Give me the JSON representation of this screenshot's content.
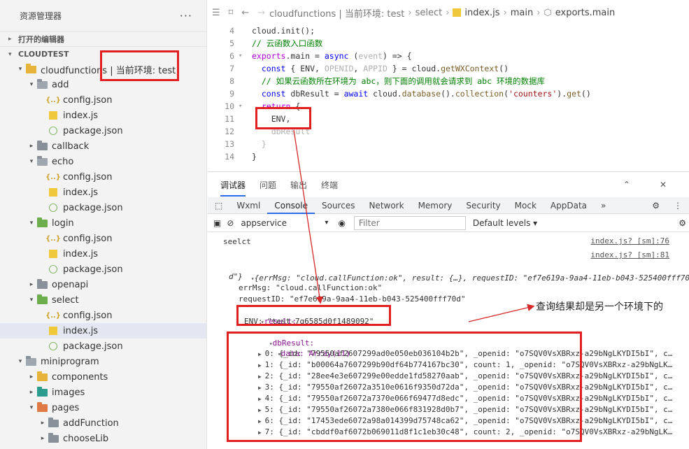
{
  "explorer": {
    "title": "资源管理器",
    "more": "···",
    "open_editors": "打开的编辑器",
    "project": "CLOUDTEST",
    "tree": [
      {
        "label": "cloudfunctions | 当前环境: test",
        "indent": 1,
        "kind": "folder-yellow-open",
        "twisty": "▾"
      },
      {
        "label": "add",
        "indent": 2,
        "kind": "folder-open",
        "twisty": "▾"
      },
      {
        "label": "config.json",
        "indent": 3,
        "kind": "json"
      },
      {
        "label": "index.js",
        "indent": 3,
        "kind": "js"
      },
      {
        "label": "package.json",
        "indent": 3,
        "kind": "pkg"
      },
      {
        "label": "callback",
        "indent": 2,
        "kind": "folder",
        "twisty": "▸"
      },
      {
        "label": "echo",
        "indent": 2,
        "kind": "folder-open",
        "twisty": "▾"
      },
      {
        "label": "config.json",
        "indent": 3,
        "kind": "json"
      },
      {
        "label": "index.js",
        "indent": 3,
        "kind": "js"
      },
      {
        "label": "package.json",
        "indent": 3,
        "kind": "pkg"
      },
      {
        "label": "login",
        "indent": 2,
        "kind": "folder-green-open",
        "twisty": "▾"
      },
      {
        "label": "config.json",
        "indent": 3,
        "kind": "json"
      },
      {
        "label": "index.js",
        "indent": 3,
        "kind": "js"
      },
      {
        "label": "package.json",
        "indent": 3,
        "kind": "pkg"
      },
      {
        "label": "openapi",
        "indent": 2,
        "kind": "folder",
        "twisty": "▸"
      },
      {
        "label": "select",
        "indent": 2,
        "kind": "folder-green-open",
        "twisty": "▾"
      },
      {
        "label": "config.json",
        "indent": 3,
        "kind": "json"
      },
      {
        "label": "index.js",
        "indent": 3,
        "kind": "js",
        "selected": true
      },
      {
        "label": "package.json",
        "indent": 3,
        "kind": "pkg"
      },
      {
        "label": "miniprogram",
        "indent": 1,
        "kind": "folder-open",
        "twisty": "▾"
      },
      {
        "label": "components",
        "indent": 2,
        "kind": "folder-yellow",
        "twisty": "▸"
      },
      {
        "label": "images",
        "indent": 2,
        "kind": "folder-teal",
        "twisty": "▸"
      },
      {
        "label": "pages",
        "indent": 2,
        "kind": "folder-orange-open",
        "twisty": "▾"
      },
      {
        "label": "addFunction",
        "indent": 3,
        "kind": "folder",
        "twisty": "▸"
      },
      {
        "label": "chooseLib",
        "indent": 3,
        "kind": "folder",
        "twisty": "▸"
      }
    ]
  },
  "breadcrumb": {
    "items": [
      "cloudfunctions | 当前环境: test",
      "select",
      "index.js",
      "main",
      "exports.main"
    ]
  },
  "editor": {
    "lines": [
      {
        "n": "4",
        "html": "cloud.init();"
      },
      {
        "n": "5",
        "html": "<span class='cm'>// 云函数入口函数</span>"
      },
      {
        "n": "6",
        "fold": "▾",
        "html": "<span class='kw2'>exports</span>.main = <span class='kw'>async</span> (<span class='pr'>event</span>) =&gt; {"
      },
      {
        "n": "7",
        "html": "  <span class='kw'>const</span> { ENV, <span class='pr'>OPENID</span>, <span class='pr'>APPID</span> } = cloud.<span class='fn'>getWXContext</span>()"
      },
      {
        "n": "8",
        "html": "  <span class='cm'>// 如果云函数所在环境为 abc，则下面的调用就会请求到 abc 环境的数据库</span>"
      },
      {
        "n": "9",
        "html": "  <span class='kw'>const</span> dbResult = <span class='kw'>await</span> cloud.<span class='fn'>database</span>().<span class='fn'>collection</span>(<span class='st'>'counters'</span>).<span class='fn'>get</span>()"
      },
      {
        "n": "10",
        "fold": "▾",
        "html": "  <span class='kw2'>return</span> {"
      },
      {
        "n": "11",
        "html": "    ENV,"
      },
      {
        "n": "12",
        "html": "    <span class='pr'>dbResult</span>"
      },
      {
        "n": "13",
        "html": "  <span class='pr'>}</span>"
      },
      {
        "n": "14",
        "html": "}"
      }
    ]
  },
  "devtools": {
    "tabs": [
      "调试器",
      "问题",
      "输出",
      "终端"
    ],
    "panel_tabs": [
      "Wxml",
      "Console",
      "Sources",
      "Network",
      "Memory",
      "Security",
      "Mock",
      "AppData"
    ],
    "context": "appservice",
    "filter_placeholder": "Filter",
    "levels": "Default levels ▾"
  },
  "console": {
    "log1": "seelct",
    "src1": "index.js? [sm]:76",
    "src2": "index.js? [sm]:81",
    "obj_line1": "{errMsg: \"cloud.callFunction:ok\", result: {…}, requestID: \"ef7e619a-9aa4-11eb-b043-525400fff70",
    "obj_line2": "d\"}",
    "errMsg": "errMsg: \"cloud.callFunction:ok\"",
    "requestID": "requestID: \"ef7e619a-9aa4-11eb-b043-525400fff70d\"",
    "result": "result:",
    "env": "ENV: \"test-7g6585d0f1489092\"",
    "dbResult": "dbResult:",
    "data": "data: Array(11)",
    "rows": [
      "0: {_id: \"79550af2607299ad0e050eb036104b2b\", _openid: \"o7SQV0VsXBRxz-a29bNgLKYDI5bI\", c…",
      "1: {_id: \"b00064a7607299b90df64b774167bc30\", count: 1, _openid: \"o7SQV0VsXBRxz-a29bNgLK…",
      "2: {_id: \"28ee4e3e607299e00edde1fd58270aab\", _openid: \"o7SQV0VsXBRxz-a29bNgLKYDI5bI\", c…",
      "3: {_id: \"79550af26072a3510e0616f9350d72da\", _openid: \"o7SQV0VsXBRxz-a29bNgLKYDI5bI\", c…",
      "4: {_id: \"79550af26072a7370e066f69477d8edc\", _openid: \"o7SQV0VsXBRxz-a29bNgLKYDI5bI\", c…",
      "5: {_id: \"79550af26072a7380e066f831928d0b7\", _openid: \"o7SQV0VsXBRxz-a29bNgLKYDI5bI\", c…",
      "6: {_id: \"17453ede6072a98a014399d75748ca62\", _openid: \"o7SQV0VsXBRxz-a29bNgLKYDI5bI\", c…",
      "7: {_id: \"cbddf0af6072b069011d8f1c1eb30c48\", count: 2, _openid: \"o7SQV0VsXBRxz-a29bNgLK…"
    ]
  },
  "annotation": {
    "note": "查询结果却是另一个环境下的"
  }
}
